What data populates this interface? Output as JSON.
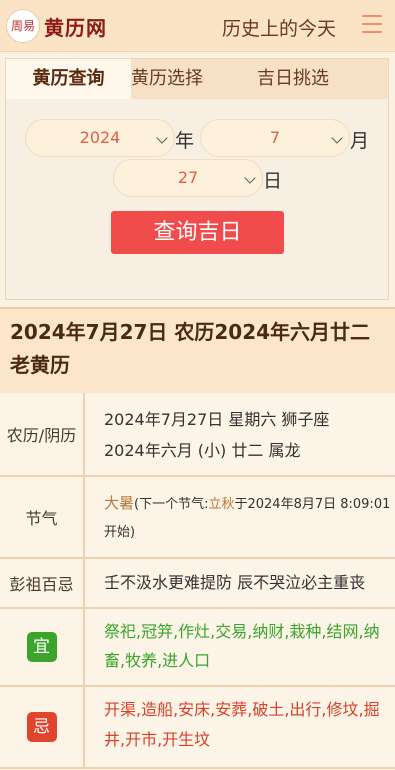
{
  "header": {
    "logo_seal": "周易",
    "logo_text": "黄历网",
    "link": "历史上的今天"
  },
  "tabs": [
    {
      "label": "黄历查询",
      "active": true
    },
    {
      "label": "黄历选择",
      "active": false
    },
    {
      "label": "吉日挑选",
      "active": false
    }
  ],
  "form": {
    "year": "2024",
    "year_unit": "年",
    "month": "7",
    "month_unit": "月",
    "day": "27",
    "day_unit": "日",
    "submit": "查询吉日"
  },
  "title": "2024年7月27日 农历2024年六月廿二老黄历",
  "rows": {
    "lunar": {
      "label": "农历/阴历",
      "line1": "2024年7月27日 星期六 狮子座",
      "line2": "2024年六月 (小) 廿二 属龙"
    },
    "jieqi": {
      "label": "节气",
      "current": "大暑",
      "prefix": "(下一个节气:",
      "next": "立秋",
      "suffix": "于2024年8月7日 8:09:01开始)"
    },
    "pengzu": {
      "label": "彭祖百忌",
      "text": "壬不汲水更难提防 辰不哭泣必主重丧"
    },
    "yi": {
      "label": "宜",
      "text": "祭祀,冠笄,作灶,交易,纳财,栽种,结网,纳畜,牧养,进人口"
    },
    "ji": {
      "label": "忌",
      "text": "开渠,造船,安床,安葬,破土,出行,修坟,掘井,开市,开生坟"
    }
  },
  "colors": {
    "accent_red": "#f04c4c",
    "yi_badge": "#3aa52a",
    "ji_badge": "#e0452b"
  }
}
